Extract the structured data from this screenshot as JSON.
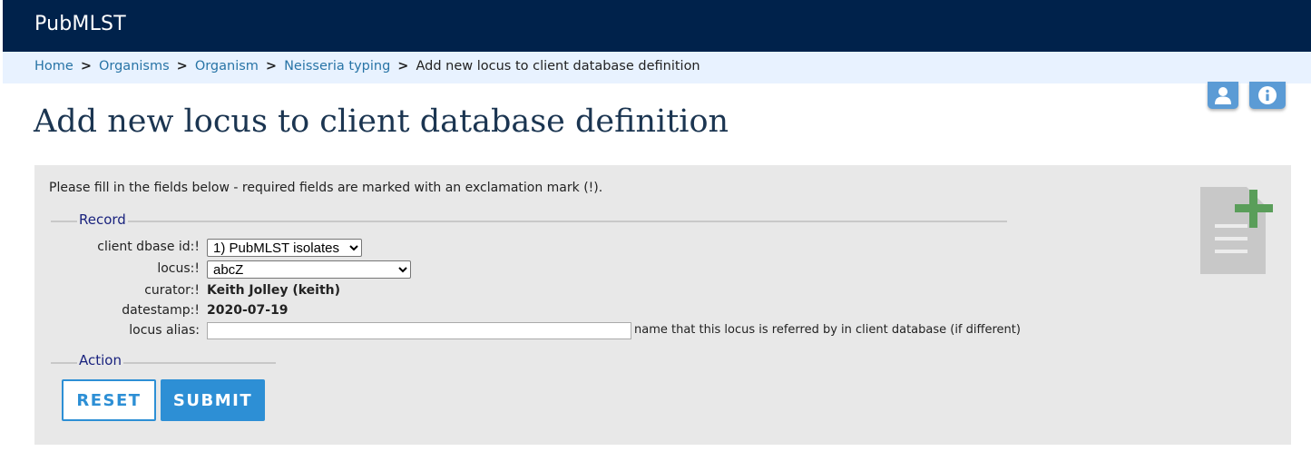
{
  "app": {
    "brand": "PubMLST"
  },
  "breadcrumbs": [
    {
      "label": "Home"
    },
    {
      "label": "Organisms"
    },
    {
      "label": "Organism"
    },
    {
      "label": "Neisseria typing"
    },
    {
      "label": "Add new locus to client database definition"
    }
  ],
  "breadcrumb_separator": ">",
  "toolbar": {
    "icons": [
      "user-icon",
      "info-icon"
    ]
  },
  "page": {
    "title": "Add new locus to client database definition"
  },
  "form": {
    "intro": "Please fill in the fields below - required fields are marked with an exclamation mark (!).",
    "record_legend": "Record",
    "action_legend": "Action",
    "fields": {
      "client_dbase_id": {
        "label": "client dbase id:!",
        "value": "1) PubMLST isolates"
      },
      "locus": {
        "label": "locus:!",
        "value": "abcZ"
      },
      "curator": {
        "label": "curator:!",
        "value": "Keith Jolley (keith)"
      },
      "datestamp": {
        "label": "datestamp:!",
        "value": "2020-07-19"
      },
      "locus_alias": {
        "label": "locus alias:",
        "value": "",
        "hint": "name that this locus is referred by in client database (if different)"
      }
    },
    "buttons": {
      "reset": "RESET",
      "submit": "SUBMIT"
    },
    "side_icon": "add-record-icon"
  },
  "colors": {
    "header": "#00224b",
    "breadcrumb_bg": "#e8f2ff",
    "link": "#2874a6",
    "title": "#1b3551",
    "panel": "#e8e8e8",
    "legend": "#1a237e",
    "button": "#2d8fd5",
    "add_icon_plus": "#5a9e5a"
  }
}
